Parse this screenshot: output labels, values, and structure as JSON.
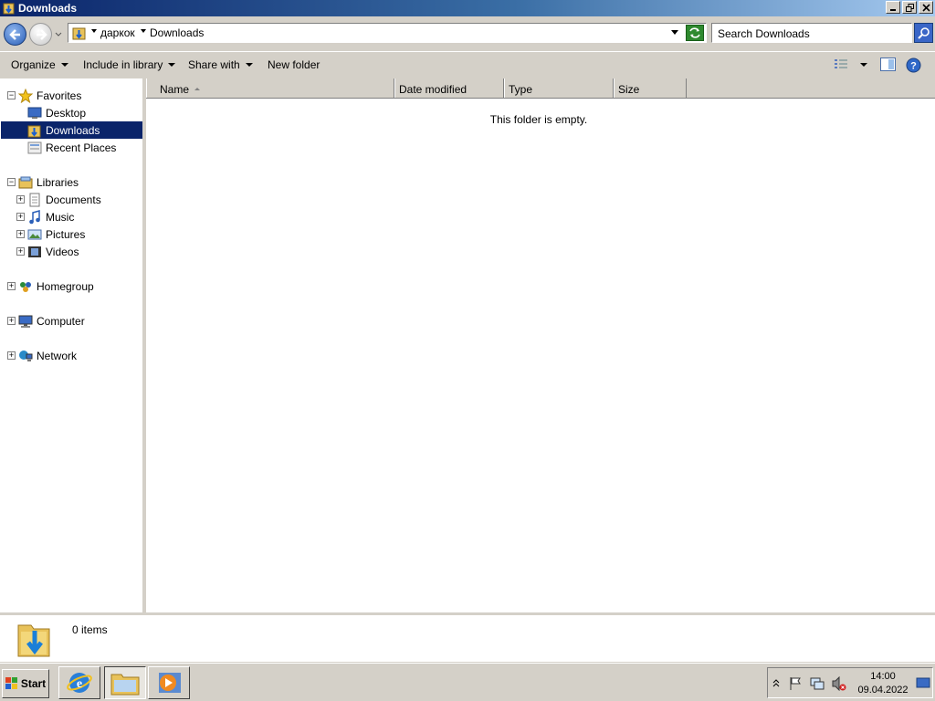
{
  "window": {
    "title": "Downloads"
  },
  "address": {
    "crumbs": [
      "даркок",
      "Downloads"
    ],
    "search_placeholder": "Search Downloads"
  },
  "toolbar": {
    "organize": "Organize",
    "include_in_library": "Include in library",
    "share_with": "Share with",
    "new_folder": "New folder"
  },
  "nav": {
    "favorites": "Favorites",
    "desktop": "Desktop",
    "downloads": "Downloads",
    "recent_places": "Recent Places",
    "libraries": "Libraries",
    "documents": "Documents",
    "music": "Music",
    "pictures": "Pictures",
    "videos": "Videos",
    "homegroup": "Homegroup",
    "computer": "Computer",
    "network": "Network"
  },
  "columns": {
    "name": "Name",
    "date_modified": "Date modified",
    "type": "Type",
    "size": "Size"
  },
  "content": {
    "empty_message": "This folder is empty."
  },
  "details": {
    "item_count": "0 items"
  },
  "taskbar": {
    "start": "Start",
    "time": "14:00",
    "date": "09.04.2022"
  },
  "colors": {
    "selection": "#0a246a",
    "titlebar": "#0a246a",
    "chrome": "#d4d0c8"
  }
}
